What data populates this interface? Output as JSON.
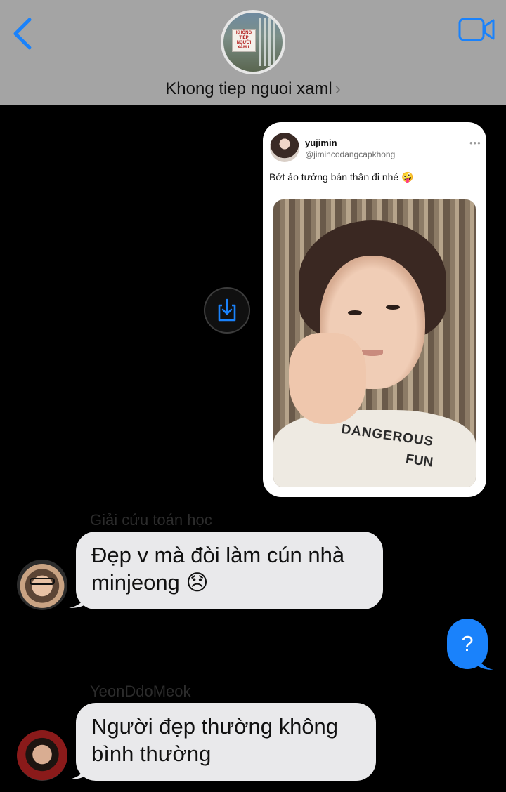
{
  "header": {
    "contact_name": "Khong tiep nguoi xaml",
    "avatar_sign_line1": "KHÔNG TIẾP",
    "avatar_sign_line2": "NGƯỜI XÀM L",
    "back_icon": "chevron-left-icon",
    "video_icon": "video-camera-icon",
    "accent_color": "#1a82fb"
  },
  "shared_post": {
    "display_name": "yujimin",
    "handle": "@jimincodangcapkhong",
    "text": "Bớt ảo tưởng bản thân đi nhé 🤪",
    "more_icon": "ellipsis-icon",
    "shirt_text_line1": "DANGEROUS",
    "shirt_text_line2": "FUN"
  },
  "download_button": {
    "icon": "download-icon"
  },
  "messages": [
    {
      "sender": "Giải cứu toán học",
      "text_line1": "Đẹp v mà đòi làm cún nhà",
      "text_line2": "minjeong 😞"
    },
    {
      "sender": "me",
      "text": "?"
    },
    {
      "sender": "YeonDdoMeok",
      "text_line1": "Người đẹp thường không",
      "text_line2": "bình thường"
    }
  ]
}
